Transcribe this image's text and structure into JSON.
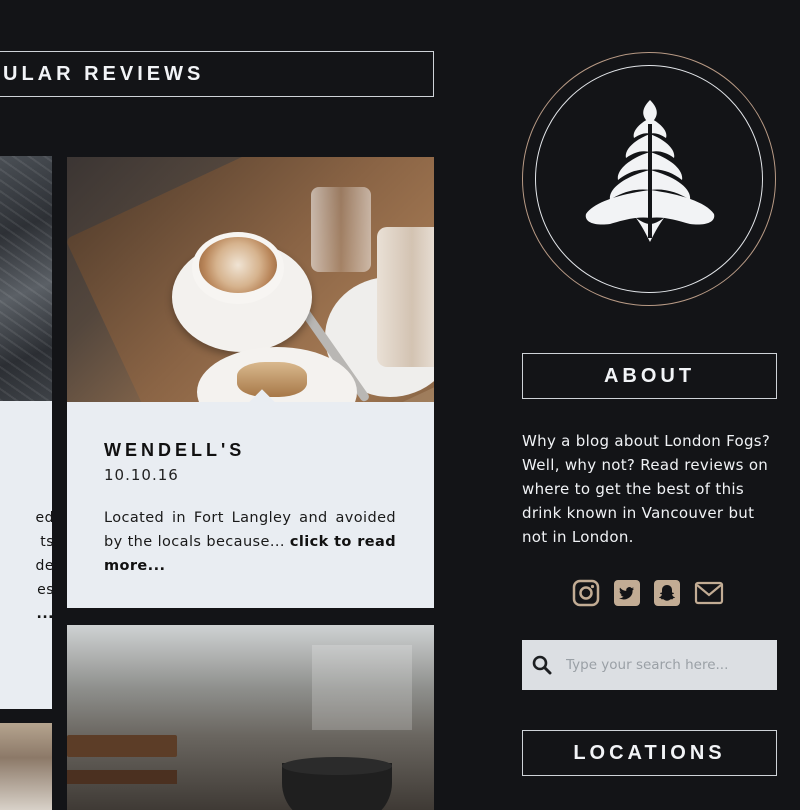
{
  "popular": {
    "title": "ULAR REVIEWS"
  },
  "left_card": {
    "text_lines": [
      "ed",
      "ts",
      "de",
      "es",
      "..."
    ]
  },
  "review": {
    "name": "WENDELL'S",
    "date": "10.10.16",
    "excerpt": "Located in Fort Langley and avoided by the locals because...",
    "link_label": "click to read more..."
  },
  "sidebar": {
    "about_title": "ABOUT",
    "about_text": "Why a blog about London Fogs? Well, why not? Read reviews on where to get the best of this drink known in Vancouver but not in London.",
    "social_icons": [
      "instagram-icon",
      "twitter-icon",
      "snapchat-icon",
      "mail-icon"
    ],
    "search_placeholder": "Type your search here...",
    "locations_title": "LOCATIONS"
  },
  "colors": {
    "background": "#131417",
    "card": "#e9edf2",
    "accent_tan": "#c2ac94",
    "ring_outer": "#b89a85"
  }
}
